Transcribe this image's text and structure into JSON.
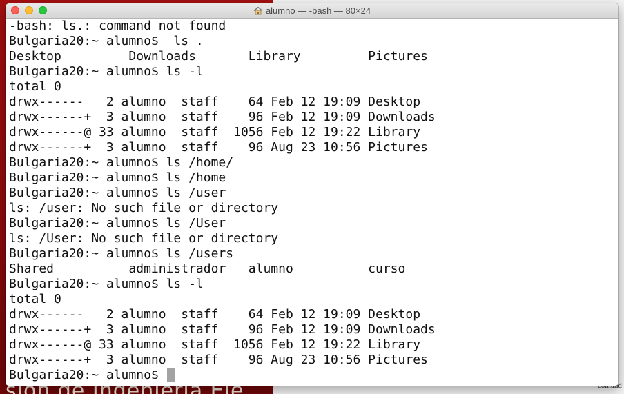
{
  "window": {
    "title": "alumno — -bash — 80×24"
  },
  "background": {
    "left_banner_text": "sion de Ingenieria Ele",
    "right_edge_text": "comand"
  },
  "terminal": {
    "lines": [
      "-bash: ls.: command not found",
      "Bulgaria20:~ alumno$  ls .",
      "Desktop         Downloads       Library         Pictures",
      "Bulgaria20:~ alumno$ ls -l",
      "total 0",
      "drwx------   2 alumno  staff    64 Feb 12 19:09 Desktop",
      "drwx------+  3 alumno  staff    96 Feb 12 19:09 Downloads",
      "drwx------@ 33 alumno  staff  1056 Feb 12 19:22 Library",
      "drwx------+  3 alumno  staff    96 Aug 23 10:56 Pictures",
      "Bulgaria20:~ alumno$ ls /home/",
      "Bulgaria20:~ alumno$ ls /home",
      "Bulgaria20:~ alumno$ ls /user",
      "ls: /user: No such file or directory",
      "Bulgaria20:~ alumno$ ls /User",
      "ls: /User: No such file or directory",
      "Bulgaria20:~ alumno$ ls /users",
      "Shared          administrador   alumno          curso",
      "Bulgaria20:~ alumno$ ls -l",
      "total 0",
      "drwx------   2 alumno  staff    64 Feb 12 19:09 Desktop",
      "drwx------+  3 alumno  staff    96 Feb 12 19:09 Downloads",
      "drwx------@ 33 alumno  staff  1056 Feb 12 19:22 Library",
      "drwx------+  3 alumno  staff    96 Aug 23 10:56 Pictures"
    ],
    "prompt": "Bulgaria20:~ alumno$ "
  },
  "colors": {
    "close": "#fe5f57",
    "minimize": "#febc2e",
    "maximize": "#28c840"
  },
  "icons": {
    "title_icon": "home-folder-icon"
  }
}
